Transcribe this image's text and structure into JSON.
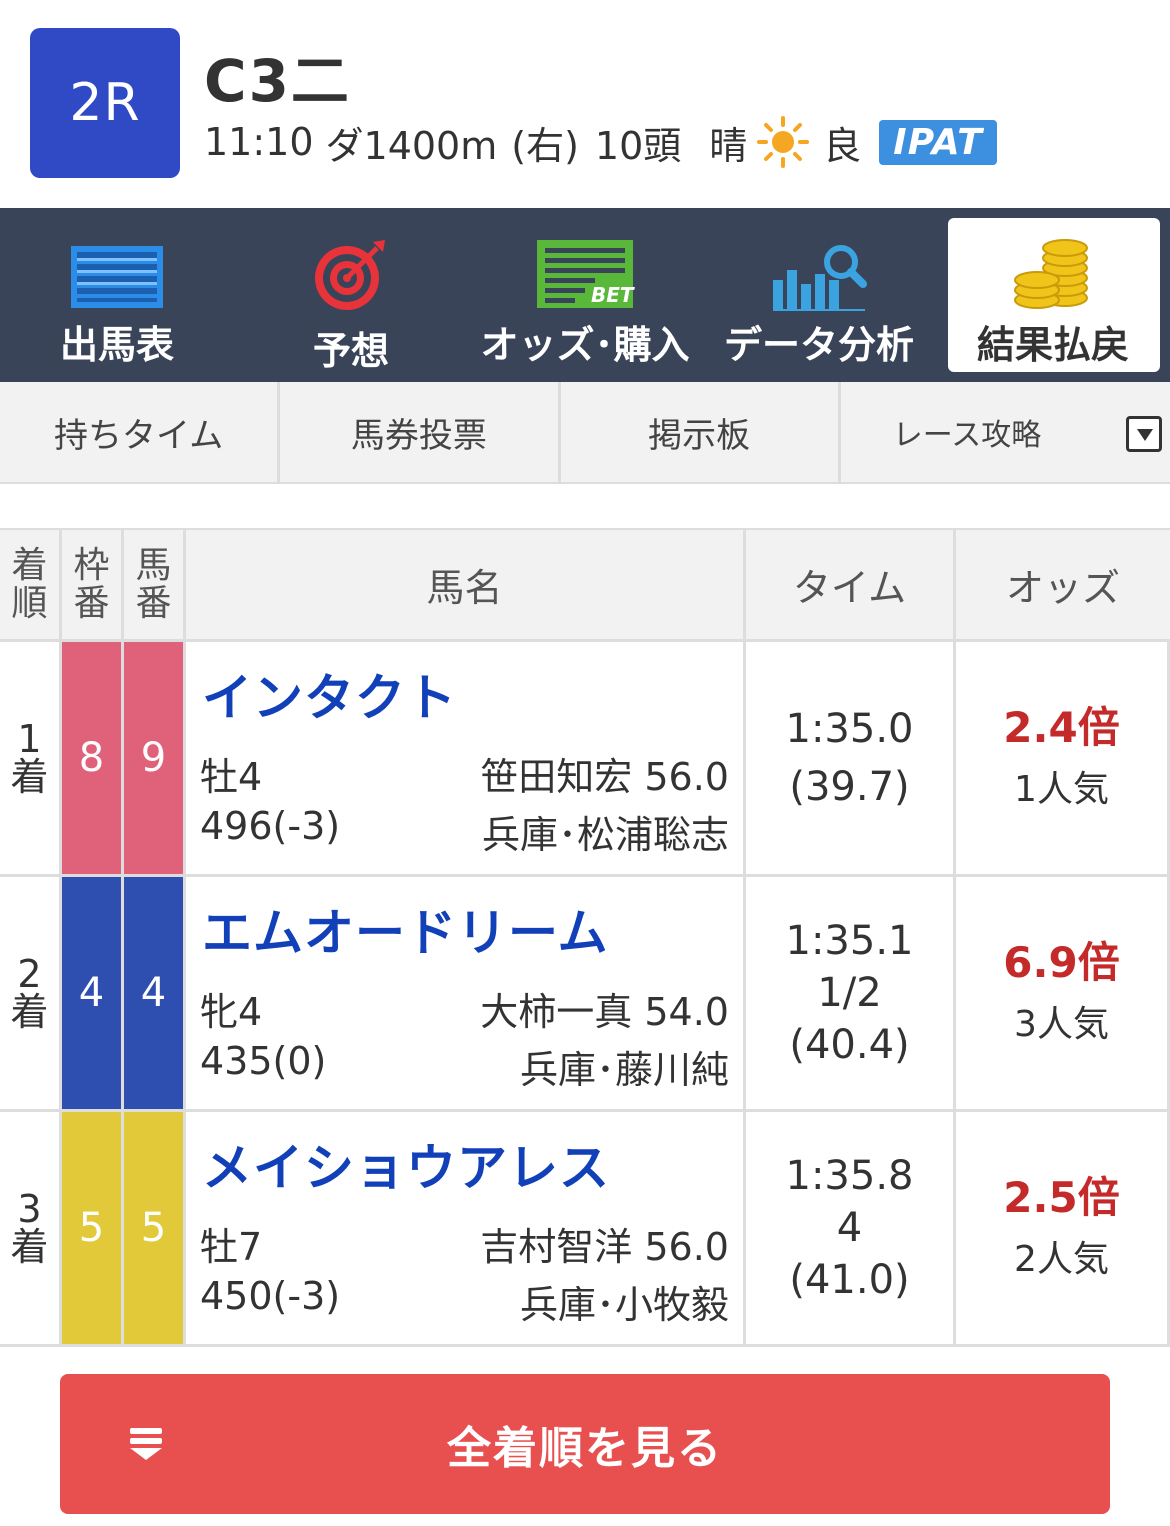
{
  "header": {
    "race_number": "2R",
    "race_class": "C3二",
    "start_time": "11:10",
    "course": "ダ1400m",
    "direction": "(右)",
    "runners": "10頭",
    "weather": "晴",
    "track_condition": "良",
    "ipat_label": "IPAT"
  },
  "mainnav": {
    "items": [
      {
        "label": "出馬表",
        "icon": "entry-table-icon"
      },
      {
        "label": "予想",
        "icon": "target-icon"
      },
      {
        "label": "オッズ･購入",
        "icon": "bet-icon"
      },
      {
        "label": "データ分析",
        "icon": "data-analysis-icon"
      },
      {
        "label": "結果払戻",
        "icon": "coins-icon"
      }
    ],
    "active_index": 4
  },
  "subnav": {
    "items": [
      "持ちタイム",
      "馬券投票",
      "掲示板",
      "レース攻略"
    ]
  },
  "table": {
    "headers": {
      "rank": [
        "着",
        "順"
      ],
      "waku": [
        "枠",
        "番"
      ],
      "uma": [
        "馬",
        "番"
      ],
      "name": "馬名",
      "time": "タイム",
      "odds": "オッズ"
    },
    "rows": [
      {
        "rank_num": "1",
        "rank_suffix": "着",
        "waku": "8",
        "uma": "9",
        "name": "インタクト",
        "sex_age": "牡4",
        "body_weight": "496(-3)",
        "jockey": "笹田知宏 56.0",
        "trainer": "兵庫･松浦聡志",
        "time": "1:35.0",
        "margin": "",
        "last3f": "(39.7)",
        "odds": "2.4倍",
        "popularity": "1人気"
      },
      {
        "rank_num": "2",
        "rank_suffix": "着",
        "waku": "4",
        "uma": "4",
        "name": "エムオードリーム",
        "sex_age": "牝4",
        "body_weight": "435(0)",
        "jockey": "大柿一真 54.0",
        "trainer": "兵庫･藤川純",
        "time": "1:35.1",
        "margin": "1/2",
        "last3f": "(40.4)",
        "odds": "6.9倍",
        "popularity": "3人気"
      },
      {
        "rank_num": "3",
        "rank_suffix": "着",
        "waku": "5",
        "uma": "5",
        "name": "メイショウアレス",
        "sex_age": "牡7",
        "body_weight": "450(-3)",
        "jockey": "吉村智洋 56.0",
        "trainer": "兵庫･小牧毅",
        "time": "1:35.8",
        "margin": "4",
        "last3f": "(41.0)",
        "odds": "2.5倍",
        "popularity": "2人気"
      }
    ]
  },
  "colors": {
    "waku_8": "#e0617a",
    "waku_4": "#2f4fb0",
    "waku_5": "#e2c93a",
    "accent": "#e85050",
    "nav_bg": "#3a4459"
  },
  "all_results_button": "全着順を見る"
}
